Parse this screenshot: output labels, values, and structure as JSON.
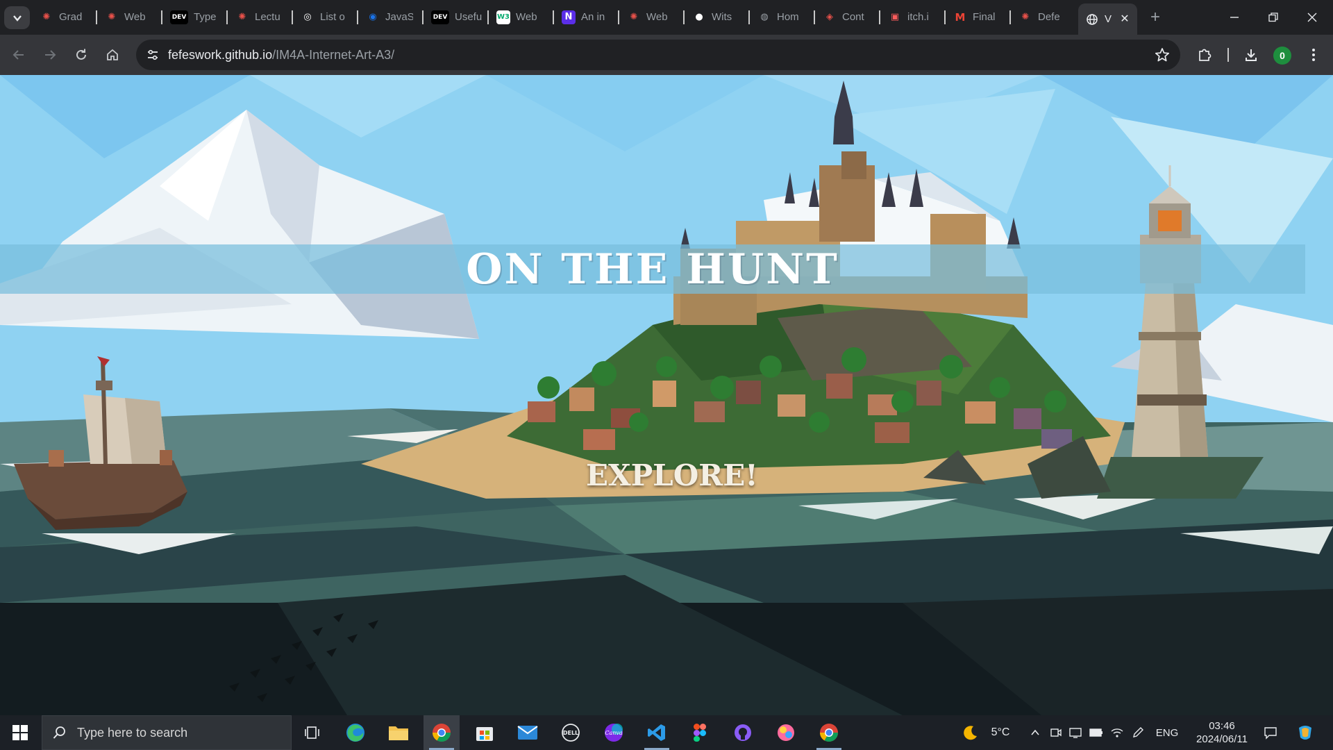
{
  "browser": {
    "tabs": [
      {
        "title": "Grad",
        "favicon": "asterisk-red-icon",
        "color": "#e8514a"
      },
      {
        "title": "Web",
        "favicon": "asterisk-red-icon",
        "color": "#e8514a"
      },
      {
        "title": "Type",
        "favicon": "dev-icon",
        "color": "#000000"
      },
      {
        "title": "Lectu",
        "favicon": "asterisk-red-icon",
        "color": "#e8514a"
      },
      {
        "title": "List o",
        "favicon": "chatgpt-icon",
        "color": "#ffffff"
      },
      {
        "title": "JavaS",
        "favicon": "javascript-info-icon",
        "color": "#1a73e8"
      },
      {
        "title": "Usefu",
        "favicon": "dev-icon",
        "color": "#000000"
      },
      {
        "title": "Web",
        "favicon": "w3schools-icon",
        "color": "#04aa6d"
      },
      {
        "title": "An in",
        "favicon": "n-icon",
        "color": "#5b2ee8"
      },
      {
        "title": "Web",
        "favicon": "asterisk-red-icon",
        "color": "#e8514a"
      },
      {
        "title": "Wits",
        "favicon": "github-icon",
        "color": "#ffffff"
      },
      {
        "title": "Hom",
        "favicon": "globe-icon",
        "color": "#9aa0a6"
      },
      {
        "title": "Cont",
        "favicon": "cont-icon",
        "color": "#e8514a"
      },
      {
        "title": "itch.i",
        "favicon": "itch-icon",
        "color": "#fa5c5c"
      },
      {
        "title": "Final",
        "favicon": "gmail-icon",
        "color": "#ea4335"
      },
      {
        "title": "Defe",
        "favicon": "asterisk-red-icon",
        "color": "#e8514a"
      }
    ],
    "active_tab": {
      "title": "V",
      "favicon": "globe-icon"
    },
    "url_host": "fefeswork.github.io",
    "url_path": "/IM4A-Internet-Art-A3/",
    "profile_initial": "0"
  },
  "page": {
    "title": "ON THE HUNT",
    "explore_label": "EXPLORE!"
  },
  "taskbar": {
    "search_placeholder": "Type here to search",
    "apps": [
      "task-view-icon",
      "edge-icon",
      "file-explorer-icon",
      "chrome-icon",
      "store-icon",
      "mail-icon",
      "dell-icon",
      "canva-icon",
      "vscode-icon",
      "figma-icon",
      "github-desktop-icon",
      "paint-icon",
      "chrome-icon"
    ],
    "weather_temp": "5°C",
    "language": "ENG",
    "time": "03:46",
    "date": "2024/06/11"
  },
  "colors": {
    "sky": "#8fd0f0",
    "sea": "#3f6b6a",
    "title_band": "#78bedc",
    "accent_green": "#1e8e3e"
  }
}
